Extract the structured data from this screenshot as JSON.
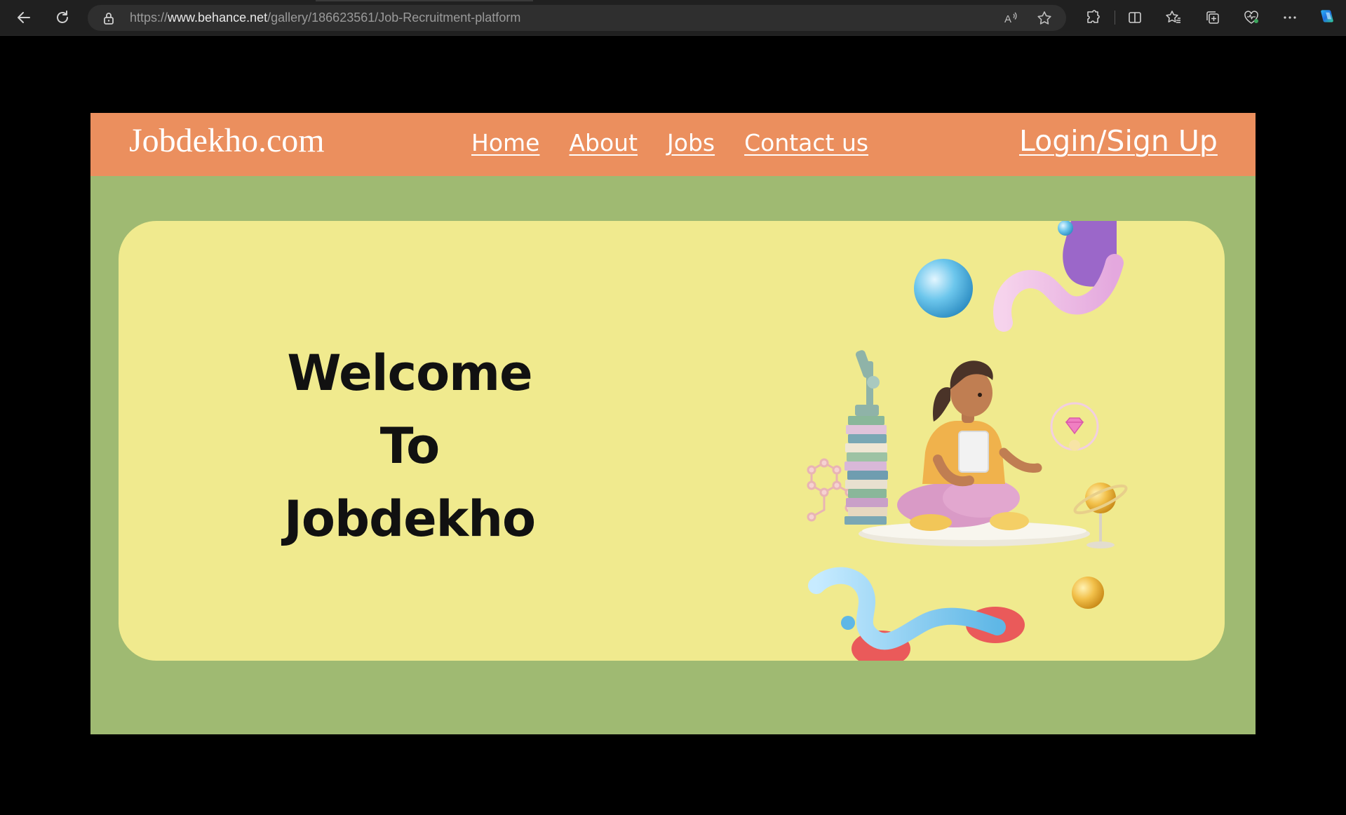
{
  "browser": {
    "url_prefix": "https://",
    "url_host": "www.behance.net",
    "url_path": "/gallery/186623561/Job-Recruitment-platform",
    "icons": {
      "back": "back-arrow-icon",
      "refresh": "refresh-icon",
      "lock": "lock-icon",
      "read_aloud": "read-aloud-icon",
      "favorite": "star-icon",
      "extensions": "puzzle-icon",
      "split_screen": "split-screen-icon",
      "favorites": "favorites-icon",
      "collections": "collections-icon",
      "health": "browser-essentials-icon",
      "more": "more-icon",
      "copilot": "copilot-icon"
    }
  },
  "site": {
    "logo": "Jobdekho.com",
    "nav": [
      "Home",
      "About",
      "Jobs",
      "Contact us"
    ],
    "login": "Login/Sign Up",
    "hero": {
      "line1": "Welcome",
      "line2": "To",
      "line3": "Jobdekho"
    },
    "colors": {
      "header": "#eb8f5e",
      "page_bg": "#9fba72",
      "hero_card": "#f0ea8e",
      "text": "#111111"
    }
  }
}
